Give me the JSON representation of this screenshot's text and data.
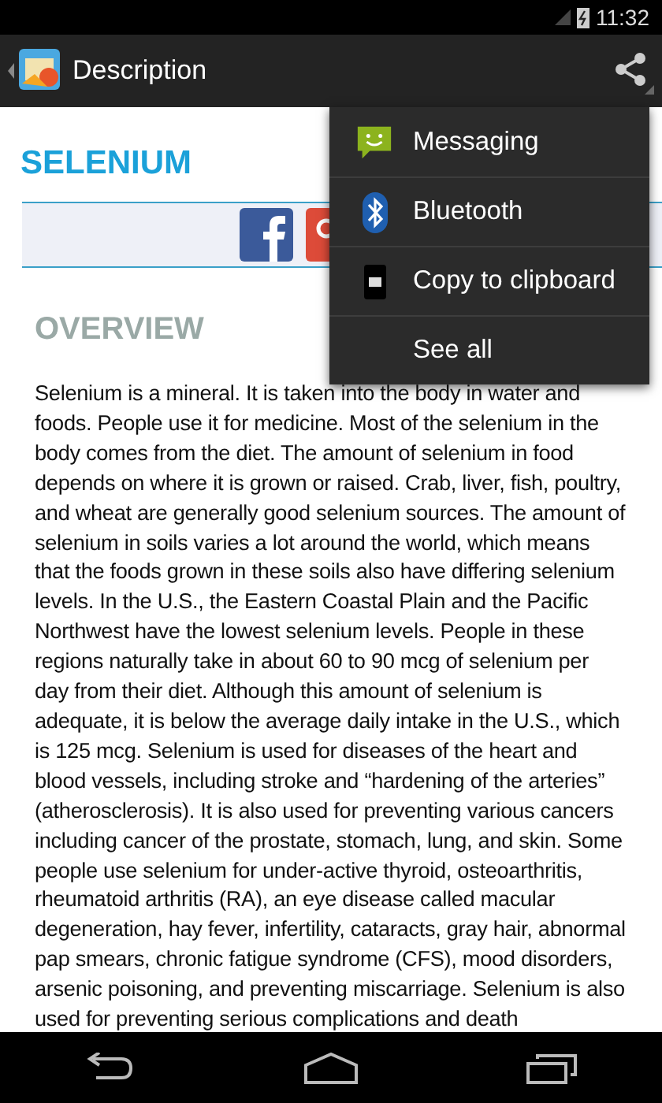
{
  "status_bar": {
    "time": "11:32"
  },
  "action_bar": {
    "title": "Description"
  },
  "article": {
    "title": "SELENIUM",
    "section": "OVERVIEW",
    "body": "Selenium is a mineral. It is taken into the body in water and foods. People use it for medicine. Most of the selenium in the body comes from the diet. The amount of selenium in food depends on where it is grown or raised. Crab, liver, fish, poultry, and wheat are generally good selenium sources. The amount of selenium in soils varies a lot around the world, which means that the foods grown in these soils also have differing selenium levels. In the U.S., the Eastern Coastal Plain and the Pacific Northwest have the lowest selenium levels. People in these regions naturally take in about 60 to 90 mcg of selenium per day from their diet. Although this amount of selenium is adequate, it is below the average daily intake in the U.S., which is 125 mcg. Selenium is used for diseases of the heart and blood vessels, including stroke and “hardening of the arteries” (atherosclerosis). It is also used for preventing various cancers including cancer of the prostate, stomach, lung, and skin. Some people use selenium for under-active thyroid, osteoarthritis, rheumatoid arthritis (RA), an eye disease called macular degeneration, hay fever, infertility, cataracts, gray hair, abnormal pap smears, chronic fatigue syndrome (CFS), mood disorders, arsenic poisoning, and preventing miscarriage. Selenium is also used for preventing serious complications and death"
  },
  "share_menu": [
    {
      "kind": "messaging",
      "label": "Messaging"
    },
    {
      "kind": "bluetooth",
      "label": "Bluetooth"
    },
    {
      "kind": "clipboard",
      "label": "Copy to clipboard"
    },
    {
      "kind": "plain",
      "label": "See all"
    }
  ]
}
